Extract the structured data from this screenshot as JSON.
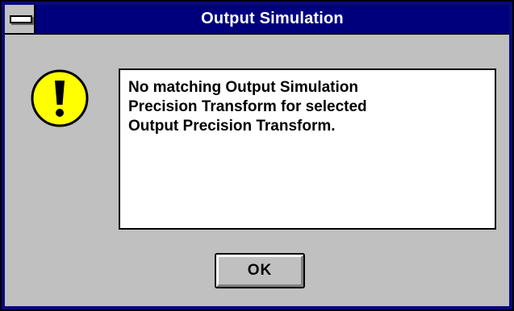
{
  "window": {
    "title": "Output Simulation",
    "colors": {
      "titlebar": "#00007c",
      "frame": "#0a0a78",
      "face": "#c0c0c0"
    }
  },
  "dialog": {
    "icon": "exclamation-icon",
    "message": "No matching Output Simulation\nPrecision Transform for selected\nOutput Precision Transform.",
    "ok_label": "OK"
  }
}
